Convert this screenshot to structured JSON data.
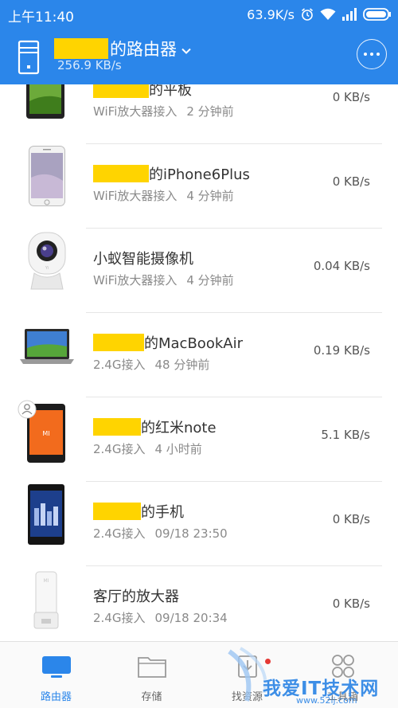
{
  "status_bar": {
    "time": "上午11:40",
    "network_speed": "63.9K/s",
    "icons": [
      "alarm-icon",
      "wifi-icon",
      "signal-icon",
      "battery-icon"
    ]
  },
  "header": {
    "title_suffix": "的路由器",
    "speed": "256.9 KB/s",
    "accent_color": "#2b86ea"
  },
  "devices": [
    {
      "name_suffix": "的平板",
      "connection": "WiFi放大器接入",
      "time": "2 分钟前",
      "speed": "0 KB/s",
      "icon": "tablet-icon"
    },
    {
      "name_suffix": "的iPhone6Plus",
      "connection": "WiFi放大器接入",
      "time": "4 分钟前",
      "speed": "0 KB/s",
      "icon": "iphone-icon"
    },
    {
      "name": "小蚁智能摄像机",
      "connection": "WiFi放大器接入",
      "time": "4 分钟前",
      "speed": "0.04 KB/s",
      "icon": "camera-icon"
    },
    {
      "name_suffix": "的MacBookAir",
      "connection": "2.4G接入",
      "time": "48 分钟前",
      "speed": "0.19 KB/s",
      "icon": "laptop-icon"
    },
    {
      "name_suffix": "的红米note",
      "connection": "2.4G接入",
      "time": "4 小时前",
      "speed": "5.1 KB/s",
      "icon": "redmi-phone-icon",
      "owner_badge": "user-icon"
    },
    {
      "name_suffix": "的手机",
      "connection": "2.4G接入",
      "time": "09/18 23:50",
      "speed": "0 KB/s",
      "icon": "mi-phone-icon"
    },
    {
      "name": "客厅的放大器",
      "connection": "2.4G接入",
      "time": "09/18 20:34",
      "speed": "0 KB/s",
      "icon": "wifi-amplifier-icon"
    }
  ],
  "bottom_nav": [
    {
      "label": "路由器",
      "icon": "router-icon",
      "active": true
    },
    {
      "label": "存储",
      "icon": "folder-icon",
      "active": false
    },
    {
      "label": "找资源",
      "icon": "download-icon",
      "active": false,
      "badge": true
    },
    {
      "label": "工具箱",
      "icon": "toolbox-icon",
      "active": false
    }
  ],
  "watermark": {
    "text": "我爱IT技术网",
    "url": "www.52ij.com"
  }
}
